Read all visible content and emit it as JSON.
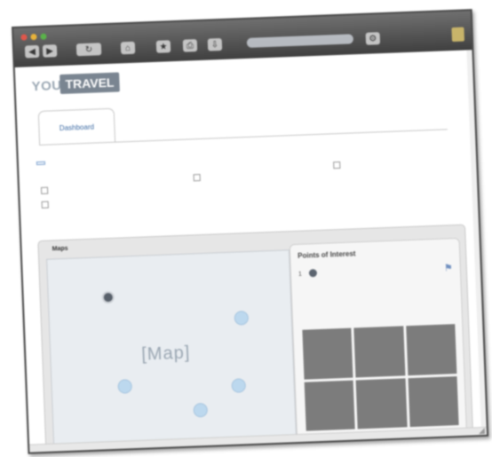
{
  "brand": {
    "you": "YOU",
    "travel": "TRAVEL"
  },
  "header": {
    "user_links": [
      "",
      ""
    ]
  },
  "tabs": [
    {
      "label": "Dashboard",
      "active": true
    },
    {
      "label": "",
      "active": false
    },
    {
      "label": "",
      "active": false
    }
  ],
  "filter": {
    "prefix": "",
    "dropdown_value": "",
    "suffix": ""
  },
  "options": {
    "first": "",
    "second": "",
    "third": "",
    "right": ""
  },
  "view_tabs": [
    "",
    "Maps",
    ""
  ],
  "map": {
    "placeholder": "[Map]"
  },
  "poi": {
    "title": "Points of Interest",
    "number": "1",
    "name": "",
    "description": ""
  },
  "colors": {
    "toolbar": "#4f4f4f",
    "brand_box": "#7a8591",
    "link": "#3c6aa3",
    "map_panel": "#e9edf1",
    "marker": "#bcd8ee"
  },
  "icons": {
    "nav_back": "arrow-left",
    "nav_forward": "arrow-right",
    "reload": "reload",
    "home": "house",
    "poi_flag": "flag"
  }
}
